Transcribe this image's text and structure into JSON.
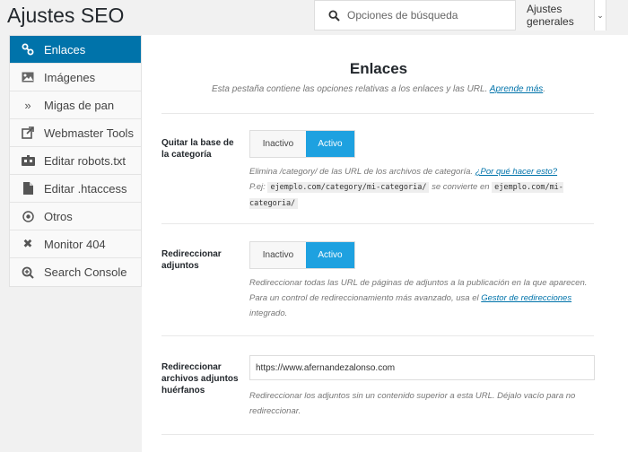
{
  "header": {
    "title": "Ajustes SEO",
    "search_placeholder": "Opciones de búsqueda",
    "scope_label": "Ajustes generales"
  },
  "sidebar": {
    "items": [
      {
        "label": "Enlaces",
        "icon": "link-icon",
        "active": true
      },
      {
        "label": "Imágenes",
        "icon": "image-icon",
        "active": false
      },
      {
        "label": "Migas de pan",
        "icon": "breadcrumb-icon",
        "active": false
      },
      {
        "label": "Webmaster Tools",
        "icon": "external-link-icon",
        "active": false
      },
      {
        "label": "Editar robots.txt",
        "icon": "robot-icon",
        "active": false
      },
      {
        "label": "Editar .htaccess",
        "icon": "file-icon",
        "active": false
      },
      {
        "label": "Otros",
        "icon": "circle-dot-icon",
        "active": false
      },
      {
        "label": "Monitor 404",
        "icon": "close-icon",
        "active": false
      },
      {
        "label": "Search Console",
        "icon": "search-console-icon",
        "active": false
      }
    ]
  },
  "main": {
    "title": "Enlaces",
    "description": "Esta pestaña contiene las opciones relativas a los enlaces y las URL.",
    "description_link": "Aprende más",
    "fields": {
      "base_categoria": {
        "label": "Quitar la base de la categoría",
        "off_label": "Inactivo",
        "on_label": "Activo",
        "value": "Activo",
        "help_prefix": "Elimina /category/ de las URL de los archivos de categoría.",
        "help_link": "¿Por qué hacer esto?",
        "help_eg": "P.ej:",
        "code1": "ejemplo.com/category/mi-categoria/",
        "help_mid": "se convierte en",
        "code2": "ejemplo.com/mi-categoria/"
      },
      "redir_adjuntos": {
        "label": "Redireccionar adjuntos",
        "off_label": "Inactivo",
        "on_label": "Activo",
        "value": "Activo",
        "help_prefix": "Redireccionar todas las URL de páginas de adjuntos a la publicación en la que aparecen. Para un control de redireccionamiento más avanzado, usa el",
        "help_link": "Gestor de redirecciones",
        "help_suffix": "integrado."
      },
      "redir_huerfanos": {
        "label": "Redireccionar archivos adjuntos huérfanos",
        "value": "https://www.afernandezalonso.com",
        "help": "Redireccionar los adjuntos sin un contenido superior a esta URL. Déjalo vacío para no redireccionar."
      }
    }
  },
  "colors": {
    "accent": "#0073aa",
    "toggle_on": "#1ea1e0"
  }
}
